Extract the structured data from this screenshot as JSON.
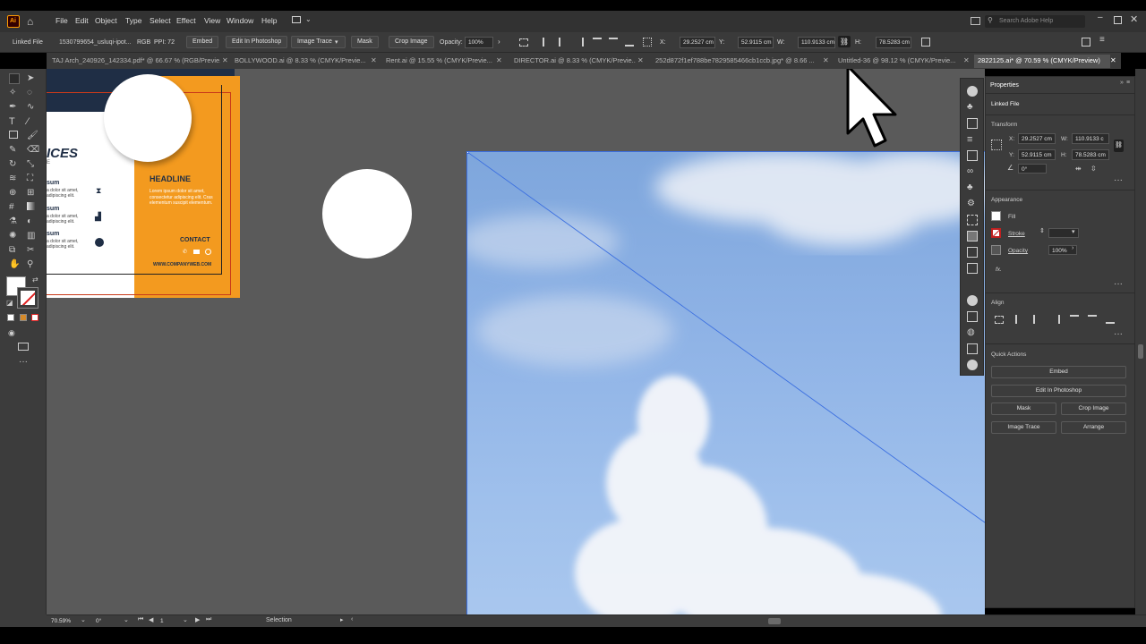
{
  "app": {
    "logo": "Ai",
    "menu": [
      "File",
      "Edit",
      "Object",
      "Type",
      "Select",
      "Effect",
      "View",
      "Window",
      "Help"
    ],
    "search_placeholder": "Search Adobe Help"
  },
  "control_bar": {
    "object_type": "Linked File",
    "file_name": "1530799654_usluqi-ipot...",
    "color_mode": "RGB",
    "ppi": "PPI: 72",
    "embed": "Embed",
    "edit_in_photoshop": "Edit In Photoshop",
    "image_trace": "Image Trace",
    "mask": "Mask",
    "crop_image": "Crop Image",
    "opacity_label": "Opacity:",
    "opacity_value": "100%",
    "x_label": "X:",
    "x_value": "29.2527 cm",
    "y_label": "Y:",
    "y_value": "52.9115 cm",
    "w_label": "W:",
    "w_value": "110.9133 cm",
    "h_label": "H:",
    "h_value": "78.5283 cm"
  },
  "tabs": [
    {
      "label": "TAJ Arch_240926_142334.pdf* @ 66.67 % (RGB/Previe...",
      "active": false
    },
    {
      "label": "BOLLYWOOD.ai @ 8.33 % (CMYK/Previe...",
      "active": false
    },
    {
      "label": "Rent.ai @ 15.55 % (CMYK/Previe...",
      "active": false
    },
    {
      "label": "DIRECTOR.ai @ 8.33 % (CMYK/Previe...",
      "active": false
    },
    {
      "label": "252d872f1ef788be7829585466cb1ccb.jpg* @ 8.66 ...",
      "active": false
    },
    {
      "label": "Untitled-36 @ 98.12 % (CMYK/Previe...",
      "active": false
    },
    {
      "label": "2822125.ai* @ 70.59 % (CMYK/Preview)",
      "active": true
    }
  ],
  "flyer": {
    "title_partial": "ICES",
    "subtitle_partial": "E",
    "items": [
      {
        "title": "sum",
        "text": "a dolor sit amet, adipiscing elit."
      },
      {
        "title": "sum",
        "text": "a dolor sit amet, adipiscing elit."
      },
      {
        "title": "sum",
        "text": "a dolor sit amet, adipiscing elit."
      }
    ],
    "headline": "HEADLINE",
    "body": "Lorem ipsum dolor sit amet, consectetur adipiscing elit. Cras elementum suscipit elementum.",
    "contact": "CONTACT",
    "website": "WWW.COMPANYWEB.COM",
    "accent": "#f39a1f"
  },
  "properties_panel": {
    "title": "Properties",
    "object_type": "Linked File",
    "transform": {
      "label": "Transform",
      "x_label": "X:",
      "x": "29.2527 cm",
      "y_label": "Y:",
      "y": "52.9115 cm",
      "w_label": "W:",
      "w": "110.9133 c",
      "h_label": "H:",
      "h": "78.5283 cm",
      "angle": "0°"
    },
    "appearance": {
      "label": "Appearance",
      "fill": "Fill",
      "stroke": "Stroke",
      "opacity": "Opacity",
      "opacity_value": "100%",
      "fx": "fx."
    },
    "align_label": "Align",
    "quick_actions": {
      "label": "Quick Actions",
      "embed": "Embed",
      "edit_in_photoshop": "Edit In Photoshop",
      "mask": "Mask",
      "crop_image": "Crop Image",
      "image_trace": "Image Trace",
      "arrange": "Arrange"
    }
  },
  "status_bar": {
    "zoom": "70.59%",
    "rotation": "0°",
    "artboard": "1",
    "tool": "Selection"
  },
  "colors": {
    "canvas_bg": "#5a5a5a",
    "selection_line": "#3b6fe0",
    "sky_top": "#8fb3e6",
    "accent_orange": "#f39a1f"
  }
}
